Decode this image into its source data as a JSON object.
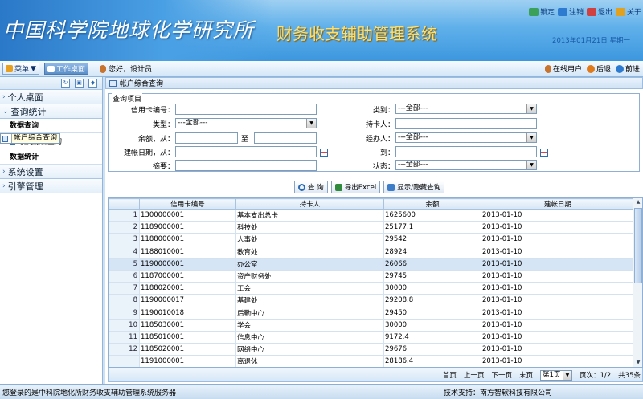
{
  "header": {
    "logo_text": "中国科学院地球化学研究所",
    "app_title": "财务收支辅助管理系统",
    "date": "2013年01月21日 星期一",
    "buttons": [
      {
        "label": "锁定",
        "color": "#3aa05a"
      },
      {
        "label": "注销",
        "color": "#2d7bd0"
      },
      {
        "label": "退出",
        "color": "#d04040"
      },
      {
        "label": "关于",
        "color": "#e0a020"
      }
    ]
  },
  "navbar": {
    "menu_label": "菜单",
    "workspace_label": "工作桌面",
    "greeting": "您好，设计员",
    "online_users": "在线用户",
    "back": "后退",
    "forward": "前进"
  },
  "sidebar": {
    "groups_top": [
      "个人桌面",
      "查询统计"
    ],
    "section1": "数据查询",
    "items": [
      "帐户综合查询",
      "收支综合查询"
    ],
    "section2": "数据统计",
    "groups_bottom": [
      "系统设置",
      "引擎管理"
    ]
  },
  "page_title": "帐户综合查询",
  "query": {
    "legend": "查询项目",
    "card_no": "信用卡编号：",
    "type": "类型：",
    "type_val": "---全部---",
    "amount_from": "余额，从：",
    "to": "至",
    "date_from": "建帐日期，从：",
    "summary": "摘要：",
    "category": "类别：",
    "category_val": "---全部---",
    "holder": "持卡人：",
    "handler": "经办人：",
    "handler_val": "---全部---",
    "date_to": "到：",
    "status": "状态：",
    "status_val": "---全部---"
  },
  "actions": {
    "search": "查 询",
    "export": "导出Excel",
    "toggle": "显示/隐藏查询"
  },
  "table": {
    "headers": [
      "信用卡编号",
      "持卡人",
      "余额",
      "建帐日期"
    ],
    "rows": [
      [
        "1",
        "1300000001",
        "基本支出总卡",
        "1625600",
        "2013-01-10"
      ],
      [
        "2",
        "1189000001",
        "科技处",
        "25177.1",
        "2013-01-10"
      ],
      [
        "3",
        "1188000001",
        "人事处",
        "29542",
        "2013-01-10"
      ],
      [
        "4",
        "1188010001",
        "教育处",
        "28924",
        "2013-01-10"
      ],
      [
        "5",
        "1190000001",
        "办公室",
        "26066",
        "2013-01-10"
      ],
      [
        "6",
        "1187000001",
        "资产财务处",
        "29745",
        "2013-01-10"
      ],
      [
        "7",
        "1188020001",
        "工会",
        "30000",
        "2013-01-10"
      ],
      [
        "8",
        "1190000017",
        "基建处",
        "29208.8",
        "2013-01-10"
      ],
      [
        "9",
        "1190010018",
        "后勤中心",
        "29450",
        "2013-01-10"
      ],
      [
        "10",
        "1185030001",
        "学会",
        "30000",
        "2013-01-10"
      ],
      [
        "11",
        "1185010001",
        "信息中心",
        "9172.4",
        "2013-01-10"
      ],
      [
        "12",
        "1185020001",
        "网络中心",
        "29676",
        "2013-01-10"
      ],
      [
        "",
        "1191000001",
        "离退休",
        "28186.4",
        "2013-01-10"
      ]
    ],
    "highlight_row": 4
  },
  "pager": {
    "first": "首页",
    "prev": "上一页",
    "next": "下一页",
    "last": "末页",
    "page_sel": "第1页",
    "page_info": "页次：1/2",
    "total": "共35条"
  },
  "status": {
    "left": "您登录的是中科院地化所财务收支辅助管理系统服务器",
    "right": "技术支持：南方智软科技有限公司"
  }
}
